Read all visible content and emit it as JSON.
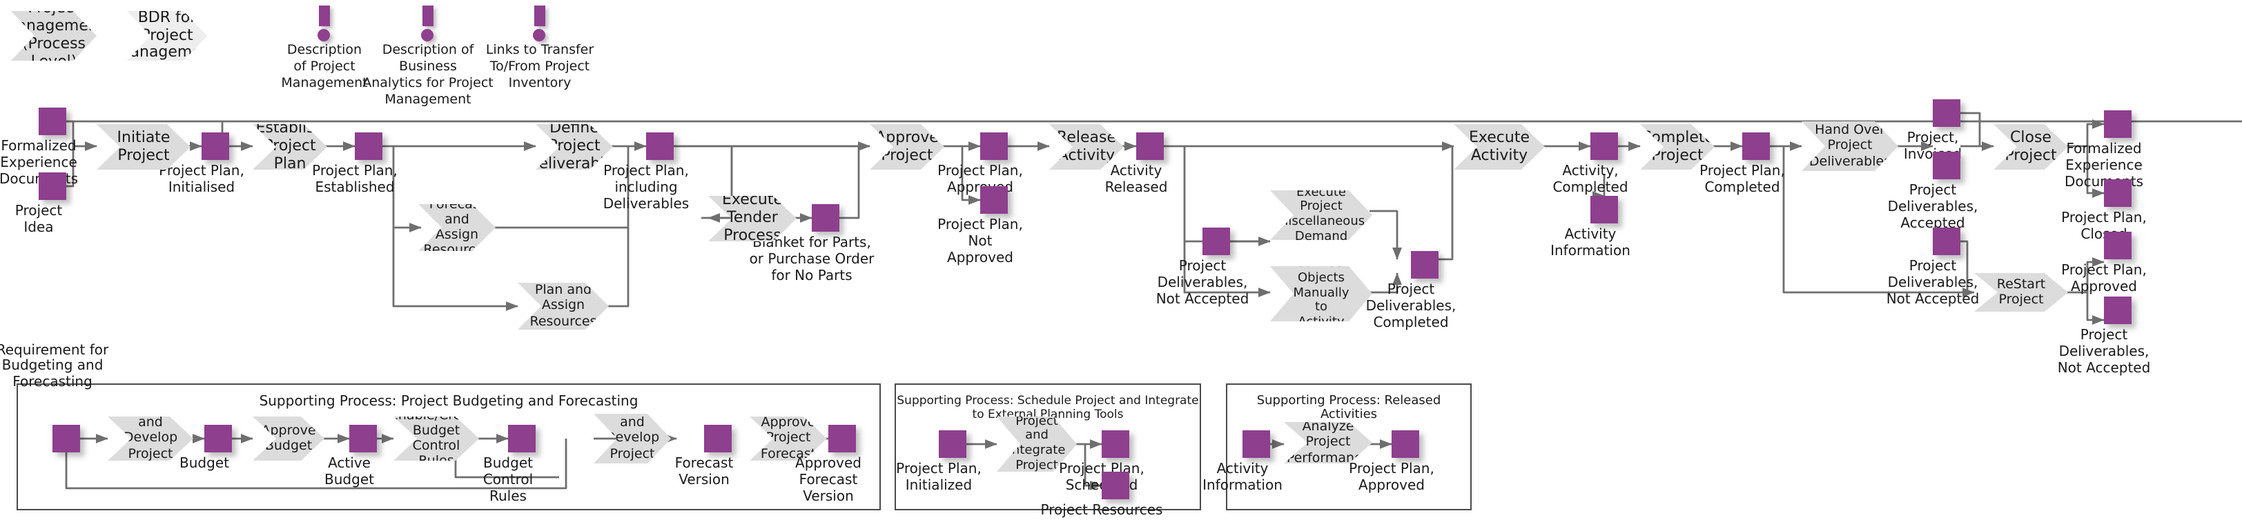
{
  "diagram": {
    "title": "Project Management (Process Level)",
    "accent_color": "#8e3f8e",
    "step_color": "#dcdcdc",
    "line_color": "#6e6e6e"
  },
  "headers": [
    {
      "label": "Project\nManagement\n(Process Level)",
      "tone": "dark"
    },
    {
      "label": "BDR for\nProject\nManagement",
      "tone": "light"
    }
  ],
  "annotations": [
    {
      "label": "Description\nof Project\nManagement"
    },
    {
      "label": "Description of Business\nAnalytics for Project\nManagement"
    },
    {
      "label": "Links to Transfer\nTo/From Project\nInventory"
    }
  ],
  "main_flow": {
    "steps": [
      {
        "label": "Initiate Project"
      },
      {
        "label": "Establish\nProject Plan"
      },
      {
        "label": "Define Project\nDeliverables"
      },
      {
        "label": "Forecast and Assign\nResources"
      },
      {
        "label": "Plan and Assign\nResources"
      },
      {
        "label": "Execute Tender\nProcess"
      },
      {
        "label": "Approve\nProject"
      },
      {
        "label": "Release\nActivity"
      },
      {
        "label": "Execute Project\nMiscellaneous\nDemand"
      },
      {
        "label": "Connect\nObjects\nManually to\nActivity"
      },
      {
        "label": "Execute\nActivity"
      },
      {
        "label": "Complete\nProject"
      },
      {
        "label": "Hand Over\nProject\nDeliverables"
      },
      {
        "label": "Close Project"
      },
      {
        "label": "ReStart Project"
      }
    ],
    "states": [
      {
        "label": "Formalized\nExperience\nDocuments"
      },
      {
        "label": "Project\nIdea"
      },
      {
        "label": "Project Plan,\nInitialised"
      },
      {
        "label": "Project Plan,\nEstablished"
      },
      {
        "label": "Project Plan,\nincluding\nDeliverables"
      },
      {
        "label": "Blanket for Parts,\nor Purchase Order\nfor No Parts"
      },
      {
        "label": "Project Plan,\nApproved"
      },
      {
        "label": "Project Plan,\nNot\nApproved"
      },
      {
        "label": "Activity\nReleased"
      },
      {
        "label": "Project\nDeliverables,\nNot Accepted"
      },
      {
        "label": "Project\nDeliverables,\nCompleted"
      },
      {
        "label": "Activity,\nCompleted"
      },
      {
        "label": "Activity\nInformation"
      },
      {
        "label": "Project Plan,\nCompleted"
      },
      {
        "label": "Project,\nInvoiced"
      },
      {
        "label": "Project\nDeliverables,\nAccepted"
      },
      {
        "label": "Project\nDeliverables,\nNot Accepted"
      },
      {
        "label": "Formalized\nExperience\nDocuments"
      },
      {
        "label": "Project Plan,\nClosed"
      },
      {
        "label": "Project Plan,\nApproved"
      },
      {
        "label": "Project\nDeliverables,\nNot Accepted"
      }
    ]
  },
  "supporting_processes": [
    {
      "title": "Supporting Process: Project Budgeting and Forecasting",
      "steps": [
        {
          "label": "Create and\nDevelop\nProject Budget"
        },
        {
          "label": "Approve\nBudget"
        },
        {
          "label": "Enable/Create\nBudget Control\nRules"
        },
        {
          "label": "Create and\nDevelop\nProject\nForecast"
        },
        {
          "label": "Approve\nProject\nForecast"
        }
      ],
      "states": [
        {
          "label": "Requirement for\nBudgeting and\nForecasting"
        },
        {
          "label": "Budget"
        },
        {
          "label": "Active\nBudget"
        },
        {
          "label": "Budget\nControl\nRules"
        },
        {
          "label": "Forecast\nVersion"
        },
        {
          "label": "Approved\nForecast\nVersion"
        }
      ]
    },
    {
      "title": "Supporting Process: Schedule Project and Integrate to External Planning Tools",
      "steps": [
        {
          "label": "Schedule\nProject and\nIntegrate\nProject Data"
        }
      ],
      "states": [
        {
          "label": "Project Plan,\nInitialized"
        },
        {
          "label": "Project Plan,\nScheduled"
        },
        {
          "label": "Project Resources"
        }
      ]
    },
    {
      "title": "Supporting Process: Released Activities",
      "steps": [
        {
          "label": "Analyze Project\nPerformance"
        }
      ],
      "states": [
        {
          "label": "Activity\nInformation"
        },
        {
          "label": "Project Plan,\nApproved"
        }
      ]
    }
  ]
}
